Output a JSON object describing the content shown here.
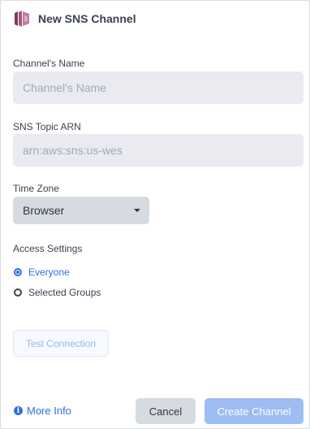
{
  "header": {
    "title": "New SNS Channel",
    "icon": "sns-logo-icon"
  },
  "channel_name": {
    "label": "Channel's Name",
    "placeholder": "Channel's Name",
    "value": ""
  },
  "topic_arn": {
    "label": "SNS Topic ARN",
    "placeholder": "arn:aws:sns:us-wes",
    "value": ""
  },
  "time_zone": {
    "label": "Time Zone",
    "selected": "Browser"
  },
  "access": {
    "label": "Access Settings",
    "options": [
      {
        "label": "Everyone",
        "checked": true
      },
      {
        "label": "Selected Groups",
        "checked": false
      }
    ]
  },
  "buttons": {
    "test": "Test Connection",
    "more_info": "More Info",
    "cancel": "Cancel",
    "create": "Create Channel"
  },
  "colors": {
    "accent": "#2f6fe0",
    "create_disabled": "#9ebdf2",
    "logo": "#a0587f"
  }
}
